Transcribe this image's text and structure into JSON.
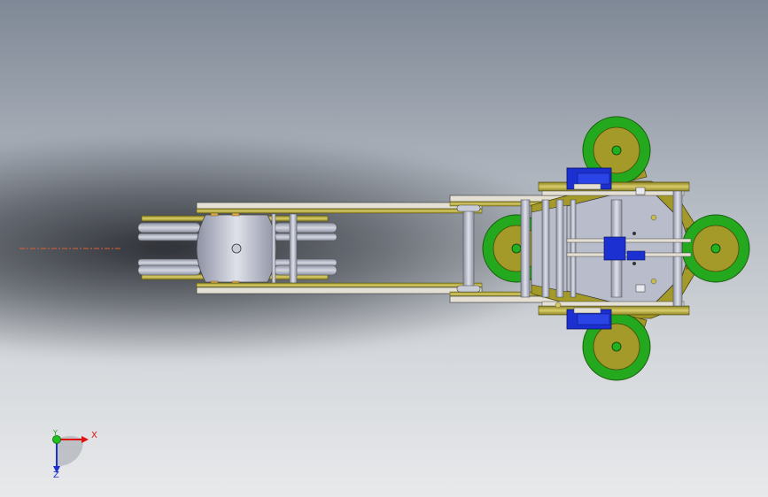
{
  "triad": {
    "x_label": "X",
    "y_label": "Y",
    "z_label": "Z"
  },
  "colors": {
    "background_top": "#7f8896",
    "background_bottom": "#e8e9eb",
    "plate_olive": "#a39a2a",
    "plate_gold": "#d8c86a",
    "steel": "#b4b8c6",
    "wheel_green": "#22a81e",
    "motor_blue": "#1c2fd0",
    "axis_x": "#e01010",
    "axis_y": "#20c020",
    "axis_z": "#2030d0"
  },
  "icons": {
    "triad": "coordinate-triad-icon"
  }
}
